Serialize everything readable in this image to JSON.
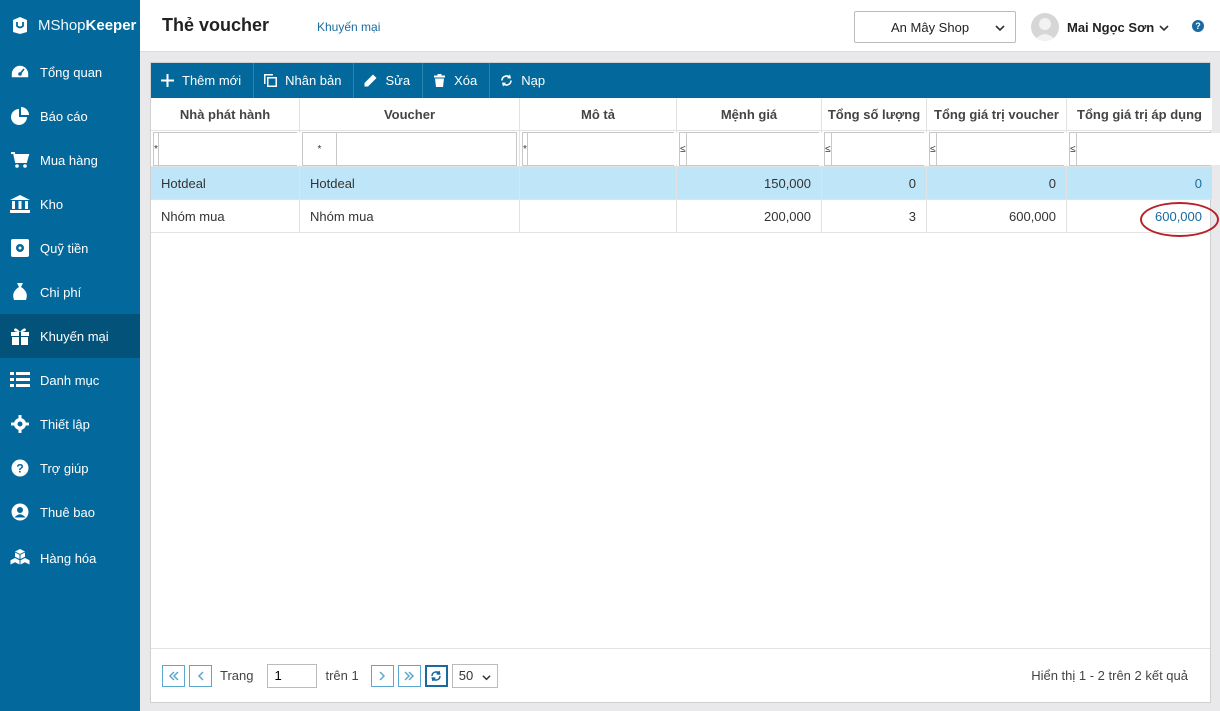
{
  "app": {
    "brand_light": "MShop",
    "brand_bold": "Keeper"
  },
  "sidebar": {
    "items": [
      {
        "label": "Tổng quan",
        "icon": "dashboard-icon"
      },
      {
        "label": "Báo cáo",
        "icon": "pie-chart-icon"
      },
      {
        "label": "Mua hàng",
        "icon": "cart-icon"
      },
      {
        "label": "Kho",
        "icon": "warehouse-icon"
      },
      {
        "label": "Quỹ tiền",
        "icon": "safe-icon"
      },
      {
        "label": "Chi phí",
        "icon": "money-bag-icon"
      },
      {
        "label": "Khuyến mại",
        "icon": "gift-icon",
        "active": true
      },
      {
        "label": "Danh mục",
        "icon": "list-icon"
      },
      {
        "label": "Thiết lập",
        "icon": "gear-icon"
      },
      {
        "label": "Trợ giúp",
        "icon": "question-icon"
      },
      {
        "label": "Thuê bao",
        "icon": "user-icon"
      },
      {
        "label": "Hàng hóa",
        "icon": "cubes-icon"
      }
    ]
  },
  "header": {
    "title": "Thẻ voucher",
    "breadcrumb": "Khuyến mại",
    "shop": "An Mây Shop",
    "user": "Mai Ngọc Sơn",
    "help": "?"
  },
  "toolbar": {
    "add": "Thêm mới",
    "duplicate": "Nhân bản",
    "edit": "Sửa",
    "delete": "Xóa",
    "reload": "Nạp"
  },
  "table": {
    "columns": [
      "Nhà phát hành",
      "Voucher",
      "Mô tả",
      "Mệnh giá",
      "Tổng số lượng",
      "Tổng giá trị voucher",
      "Tổng giá trị áp dụng"
    ],
    "filter_ops": [
      "*",
      "*",
      "*",
      "≤",
      "≤",
      "≤",
      "≤"
    ],
    "rows": [
      [
        "Hotdeal",
        "Hotdeal",
        "",
        "150,000",
        "0",
        "0",
        "0"
      ],
      [
        "Nhóm mua",
        "Nhóm mua",
        "",
        "200,000",
        "3",
        "600,000",
        "600,000"
      ]
    ]
  },
  "pager": {
    "page_label": "Trang",
    "page": "1",
    "of_label": "trên 1",
    "page_size": "50",
    "info": "Hiển thị 1 - 2 trên 2 kết quả"
  },
  "colors": {
    "accent": "#03699c",
    "selected_row": "#bfe6f8",
    "highlight": "#b8202a",
    "link": "#1a6aa0"
  }
}
